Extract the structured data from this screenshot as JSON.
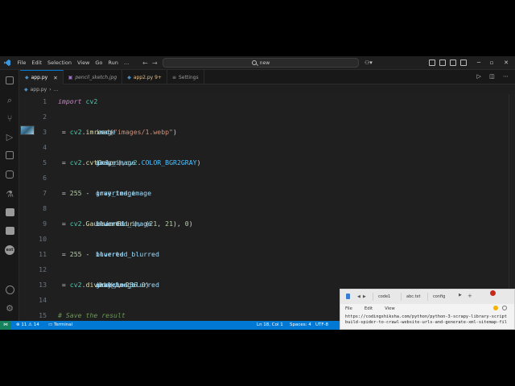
{
  "window": {
    "menu": [
      "File",
      "Edit",
      "Selection",
      "View",
      "Go",
      "Run",
      "…"
    ],
    "search_text": "new"
  },
  "tabs": [
    {
      "label": "app.py",
      "icon": "python-icon",
      "active": true
    },
    {
      "label": "pencil_sketch.jpg",
      "icon": "image-icon",
      "active": false
    },
    {
      "label": "app2.py 9+",
      "icon": "python-icon",
      "active": false
    },
    {
      "label": "Settings",
      "icon": "settings-icon",
      "active": false
    }
  ],
  "breadcrumb": {
    "file": "app.py",
    "trail": "…"
  },
  "editor": {
    "lines": [
      {
        "num": "1",
        "tokens": [
          [
            "kw",
            "import"
          ],
          [
            "plain",
            " "
          ],
          [
            "mod",
            "cv2"
          ]
        ]
      },
      {
        "num": "2",
        "tokens": []
      },
      {
        "num": "3",
        "tokens": [
          [
            "code",
            "image"
          ],
          [
            "op",
            " = "
          ],
          [
            "mod",
            "cv2"
          ],
          [
            "op",
            "."
          ],
          [
            "fn",
            "imread"
          ],
          [
            "op",
            "("
          ],
          [
            "str",
            "\"images/1.webp\""
          ],
          [
            "op",
            ")"
          ]
        ]
      },
      {
        "num": "4",
        "tokens": []
      },
      {
        "num": "5",
        "tokens": [
          [
            "code",
            "gray_image"
          ],
          [
            "op",
            " = "
          ],
          [
            "mod",
            "cv2"
          ],
          [
            "op",
            "."
          ],
          [
            "fn",
            "cvtColor"
          ],
          [
            "op",
            "("
          ],
          [
            "code",
            "image"
          ],
          [
            "op",
            ","
          ],
          [
            "mod",
            "cv2"
          ],
          [
            "op",
            "."
          ],
          [
            "const",
            "COLOR_BGR2GRAY"
          ],
          [
            "op",
            ")"
          ]
        ]
      },
      {
        "num": "6",
        "tokens": []
      },
      {
        "num": "7",
        "tokens": [
          [
            "code",
            "inverted_image"
          ],
          [
            "op",
            " = "
          ],
          [
            "num",
            "255"
          ],
          [
            "op",
            " - "
          ],
          [
            "code",
            "gray_image"
          ]
        ]
      },
      {
        "num": "8",
        "tokens": []
      },
      {
        "num": "9",
        "tokens": [
          [
            "code",
            "blurred"
          ],
          [
            "op",
            " = "
          ],
          [
            "mod",
            "cv2"
          ],
          [
            "op",
            "."
          ],
          [
            "fn",
            "GaussianBlur"
          ],
          [
            "op",
            "("
          ],
          [
            "code",
            "inverted_image"
          ],
          [
            "op",
            ", ("
          ],
          [
            "num",
            "21"
          ],
          [
            "op",
            ", "
          ],
          [
            "num",
            "21"
          ],
          [
            "op",
            "), "
          ],
          [
            "num",
            "0"
          ],
          [
            "op",
            ")"
          ]
        ]
      },
      {
        "num": "10",
        "tokens": []
      },
      {
        "num": "11",
        "tokens": [
          [
            "code",
            "inverted_blurred"
          ],
          [
            "op",
            " = "
          ],
          [
            "num",
            "255"
          ],
          [
            "op",
            " - "
          ],
          [
            "code",
            "blurred"
          ]
        ]
      },
      {
        "num": "12",
        "tokens": []
      },
      {
        "num": "13",
        "tokens": [
          [
            "code",
            "sketch"
          ],
          [
            "op",
            " = "
          ],
          [
            "mod",
            "cv2"
          ],
          [
            "op",
            "."
          ],
          [
            "fn",
            "divide"
          ],
          [
            "op",
            "("
          ],
          [
            "code",
            "gray_image"
          ],
          [
            "op",
            ","
          ],
          [
            "code",
            "inverted_blurred"
          ],
          [
            "op",
            ","
          ],
          [
            "code",
            "scale"
          ],
          [
            "op",
            "="
          ],
          [
            "num",
            "256.0"
          ],
          [
            "op",
            ")"
          ]
        ]
      },
      {
        "num": "14",
        "tokens": []
      },
      {
        "num": "15",
        "tokens": [
          [
            "cm",
            "# Save the result"
          ]
        ]
      }
    ]
  },
  "statusbar": {
    "problems": "⊗ 11 ⚠ 14",
    "terminal": "Terminal",
    "position": "Ln 18, Col 1",
    "spaces": "Spaces: 4",
    "encoding": "UTF-8"
  },
  "floating_window": {
    "tabs": [
      "code1",
      "abc.txt",
      "config"
    ],
    "menu": [
      "File",
      "Edit",
      "View"
    ],
    "text_line1": "https://codingshiksha.com/python/python-3-scrapy-library-script",
    "text_line2": "build-spider-to-crawl-website-urls-and-generate-xml-sitemap-fil"
  },
  "colors": {
    "accent": "#0078d4",
    "editor_bg": "#1f1f1f",
    "keyword": "#c586c0",
    "string": "#ce9178",
    "function": "#dcdcaa",
    "number": "#b5cea8",
    "comment": "#6a9955"
  }
}
